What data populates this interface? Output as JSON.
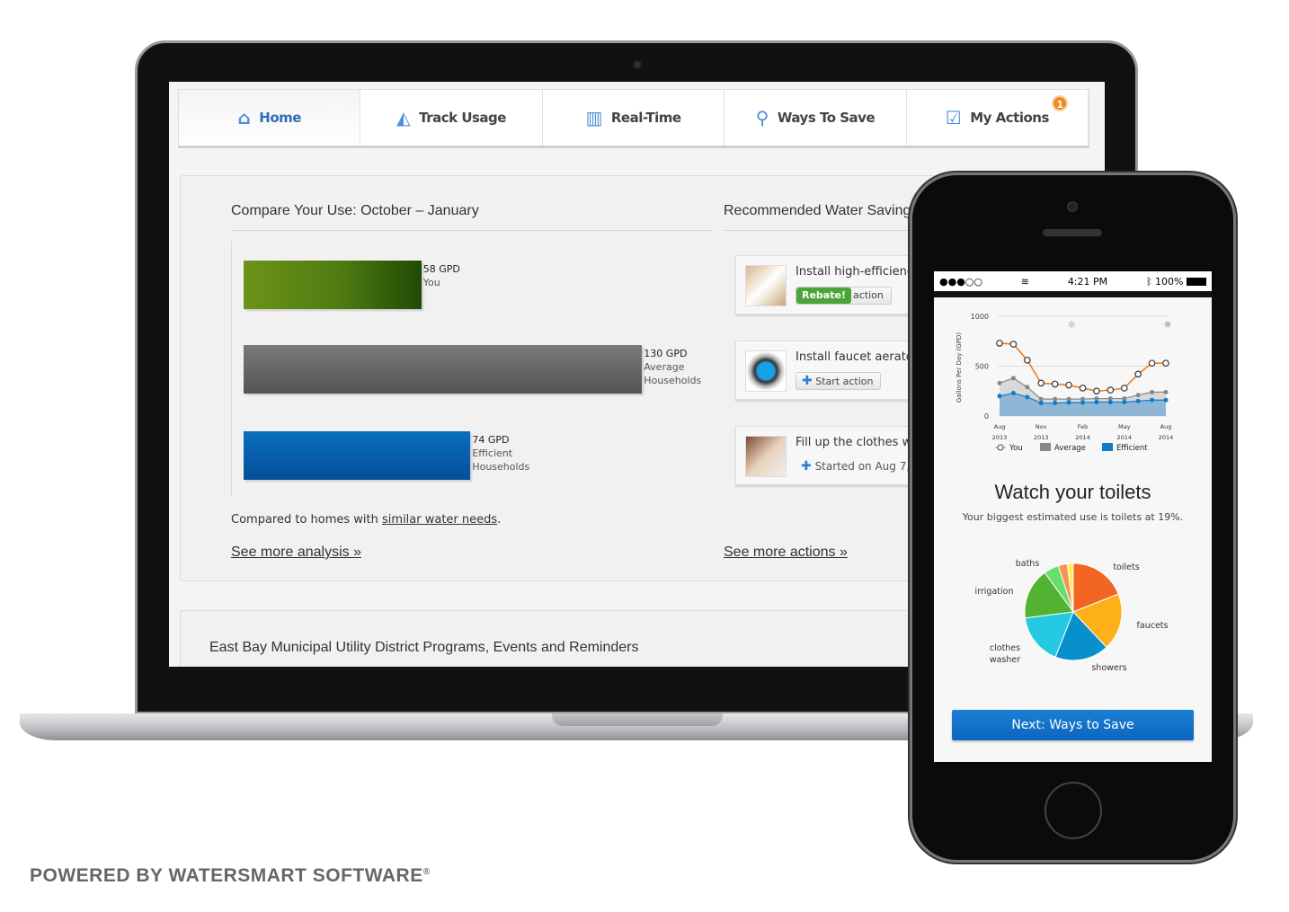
{
  "nav": {
    "tabs": [
      {
        "label": "Home",
        "icon": "house-icon"
      },
      {
        "label": "Track Usage",
        "icon": "area-chart-icon"
      },
      {
        "label": "Real-Time",
        "icon": "realtime-chart-icon"
      },
      {
        "label": "Ways To Save",
        "icon": "faucet-icon"
      },
      {
        "label": "My Actions",
        "icon": "checklist-icon",
        "badge": "1"
      }
    ]
  },
  "compare": {
    "title": "Compare Your Use: October – January",
    "note_prefix": "Compared to homes with ",
    "note_link": "similar water needs",
    "note_suffix": ".",
    "more": "See more analysis »"
  },
  "compare_chart": {
    "type": "bar",
    "orientation": "horizontal",
    "unit": "GPD",
    "series": [
      {
        "value": 58,
        "value_label": "58 GPD",
        "label": "You",
        "color": "#4f7a12"
      },
      {
        "value": 130,
        "value_label": "130 GPD",
        "label": "Average Households",
        "color": "#666666"
      },
      {
        "value": 74,
        "value_label": "74 GPD",
        "label": "Efficient Households",
        "color": "#0a5ea8"
      }
    ]
  },
  "recommended": {
    "title": "Recommended Water Saving",
    "cards": [
      {
        "title": "Install high-efficiency toilet",
        "badge": "Rebate!",
        "button": "action"
      },
      {
        "title": "Install faucet aerators",
        "button": "Start action"
      },
      {
        "title": "Fill up the clothes washer",
        "status": "Started on Aug 7, 2014"
      }
    ],
    "more": "See more actions »"
  },
  "programs": {
    "title": "East Bay Municipal Utility District Programs, Events and Reminders"
  },
  "phone": {
    "status": {
      "signal": "●●●○○",
      "time": "4:21 PM",
      "battery": "100%"
    },
    "headline": "Watch your toilets",
    "subline": "Your biggest estimated use is toilets at 19%.",
    "next_button": "Next: Ways to Save"
  },
  "chart_data": [
    {
      "type": "line",
      "ylabel": "Gallons Per Day (GPD)",
      "ylim": [
        0,
        1000
      ],
      "yticks": [
        "1000",
        "500",
        "0"
      ],
      "xticks": [
        {
          "m": "Aug",
          "y": "2013"
        },
        {
          "m": "Nov",
          "y": "2013"
        },
        {
          "m": "Feb",
          "y": "2014"
        },
        {
          "m": "May",
          "y": "2014"
        },
        {
          "m": "Aug",
          "y": "2014"
        }
      ],
      "x": [
        "Aug 2013",
        "Sep 2013",
        "Oct 2013",
        "Nov 2013",
        "Dec 2013",
        "Jan 2014",
        "Feb 2014",
        "Mar 2014",
        "Apr 2014",
        "May 2014",
        "Jun 2014",
        "Jul 2014",
        "Aug 2014"
      ],
      "series": [
        {
          "name": "You",
          "color": "#f07d1a",
          "values": [
            730,
            720,
            560,
            330,
            320,
            310,
            280,
            250,
            260,
            280,
            420,
            530,
            530
          ]
        },
        {
          "name": "Average",
          "color": "#888888",
          "values": [
            330,
            380,
            290,
            170,
            170,
            170,
            170,
            175,
            175,
            175,
            210,
            240,
            240
          ]
        },
        {
          "name": "Efficient",
          "color": "#0d7cc9",
          "values": [
            200,
            230,
            190,
            130,
            130,
            135,
            135,
            140,
            140,
            140,
            150,
            160,
            160
          ]
        }
      ]
    },
    {
      "type": "pie",
      "slices": [
        {
          "label": "toilets",
          "value": 19,
          "color": "#f26522"
        },
        {
          "label": "faucets",
          "value": 19,
          "color": "#fdb018"
        },
        {
          "label": "showers",
          "value": 18,
          "color": "#0890cb"
        },
        {
          "label": "clothes washer",
          "value": 17,
          "color": "#25c9e2"
        },
        {
          "label": "irrigation",
          "value": 17,
          "color": "#52b232"
        },
        {
          "label": "baths",
          "value": 5,
          "color": "#66e06a"
        },
        {
          "label": "",
          "value": 3,
          "color": "#f99153"
        },
        {
          "label": "",
          "value": 2,
          "color": "#fff05a"
        }
      ]
    }
  ],
  "footer": {
    "text": "POWERED BY WATERSMART SOFTWARE",
    "mark": "®"
  }
}
